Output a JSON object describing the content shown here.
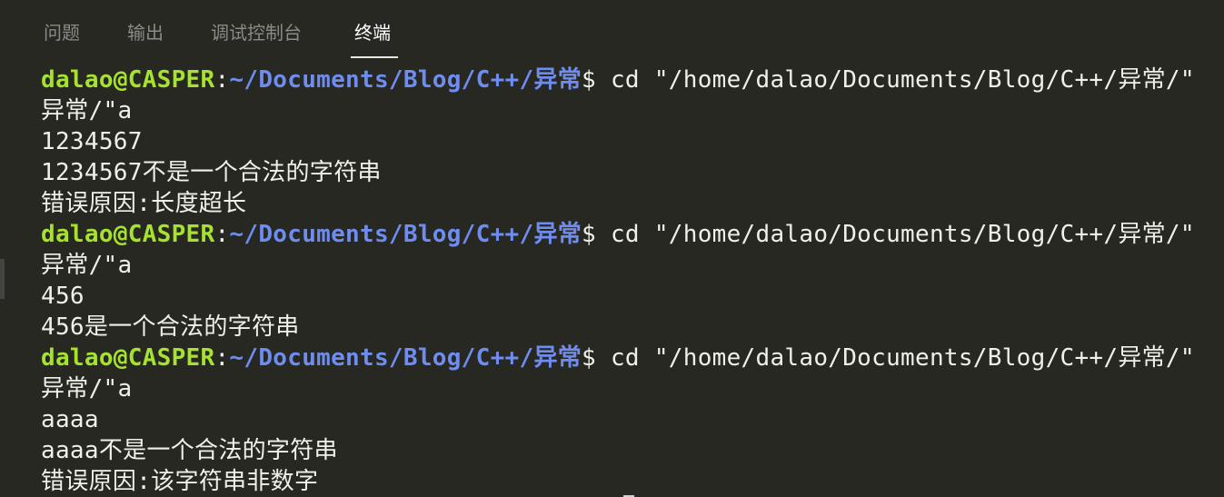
{
  "panel": {
    "tabs": [
      {
        "label": "问题"
      },
      {
        "label": "输出"
      },
      {
        "label": "调试控制台"
      },
      {
        "label": "终端"
      }
    ],
    "active_tab": "终端"
  },
  "terminal": {
    "prompt_user": "dalao@CASPER",
    "prompt_colon": ":",
    "prompt_path": "~/Documents/Blog/C++/异常",
    "prompt_symbol": "$ ",
    "command": "cd \"/home/dalao/Documents/Blog/C++/异常/\"",
    "command_continuation": "异常/\"a",
    "sessions": [
      {
        "input": "1234567",
        "output": [
          "1234567不是一个合法的字符串",
          "错误原因:长度超长"
        ]
      },
      {
        "input": "456",
        "output": [
          "456是一个合法的字符串"
        ]
      },
      {
        "input": "aaaa",
        "output": [
          "aaaa不是一个合法的字符串",
          "错误原因:该字符串非数字"
        ]
      }
    ]
  },
  "colors": {
    "background": "#272822",
    "prompt_user": "#a6e22e",
    "prompt_path": "#6f8cf0",
    "text": "#f0f0ea",
    "tab_inactive": "#8a8a86",
    "tab_active": "#ffffff"
  }
}
